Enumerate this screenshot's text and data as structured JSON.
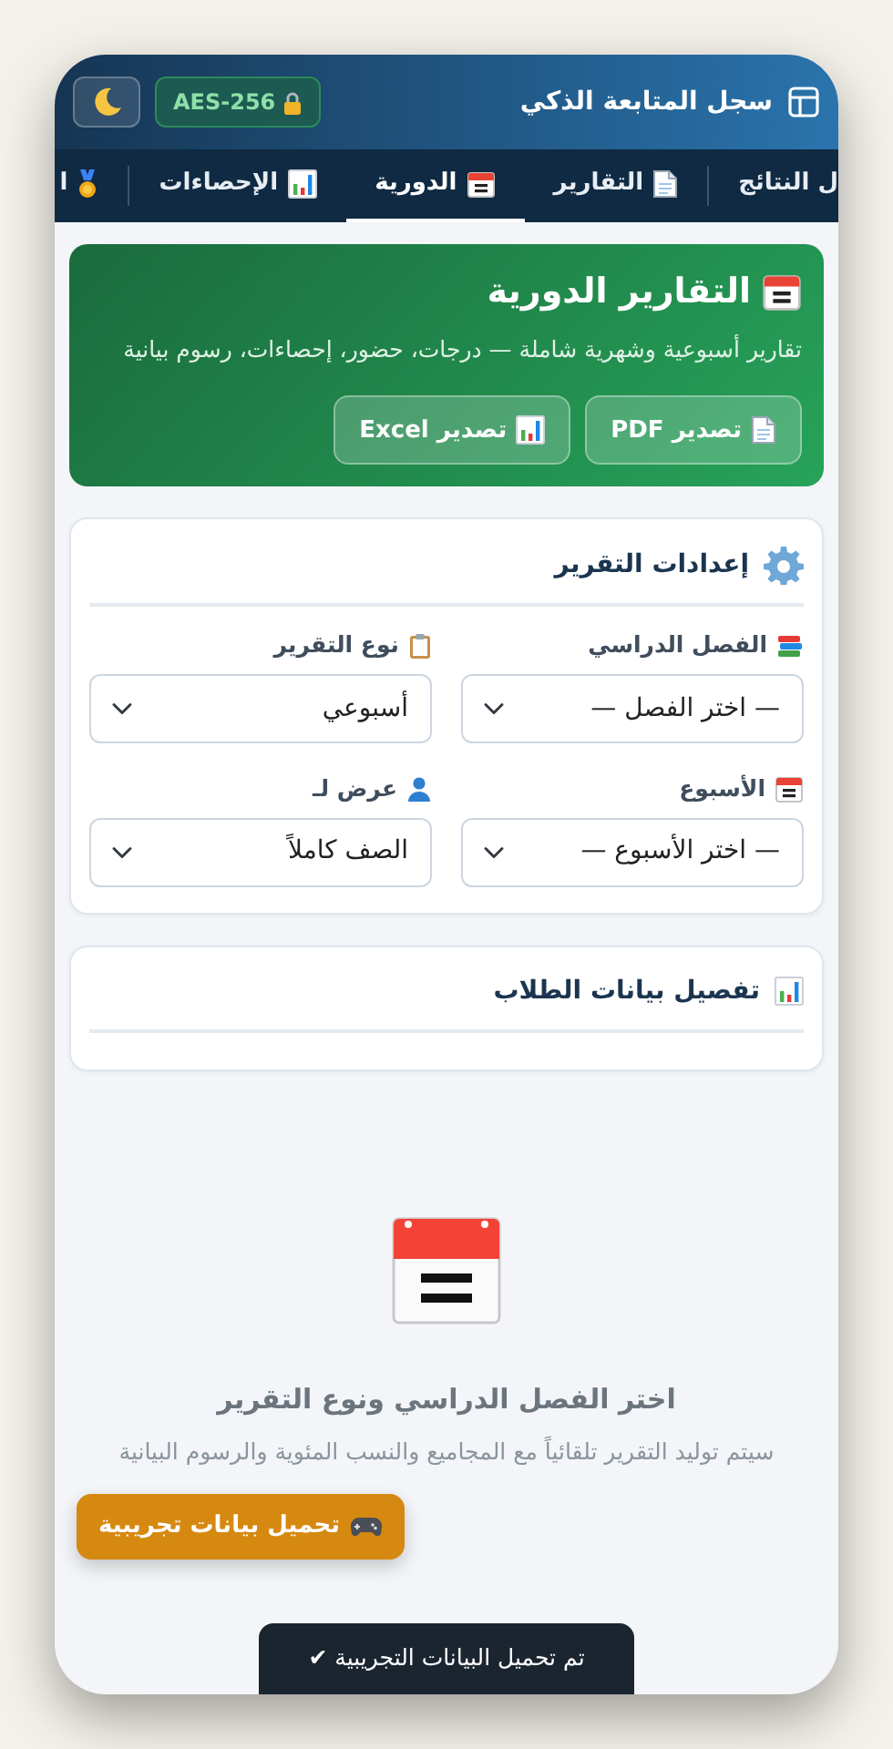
{
  "header": {
    "title": "سجل المتابعة الذكي",
    "encryption_badge": "AES-256"
  },
  "tabs": [
    {
      "label": "ل النتائج",
      "selected": false
    },
    {
      "label": "التقارير",
      "selected": false
    },
    {
      "label": "الدورية",
      "selected": true
    },
    {
      "label": "الإحصاءات",
      "selected": false
    },
    {
      "label": "ا",
      "selected": false
    }
  ],
  "hero": {
    "title": "التقارير الدورية",
    "subtitle": "تقارير أسبوعية وشهرية شاملة — درجات، حضور، إحصاءات، رسوم بيانية",
    "buttons": [
      "تصدير PDF",
      "تصدير Excel"
    ]
  },
  "settings": {
    "title": "إعدادات التقرير",
    "fields": [
      {
        "label": "الفصل الدراسي",
        "value": "— اختر الفصل —"
      },
      {
        "label": "نوع التقرير",
        "value": "أسبوعي"
      },
      {
        "label": "الأسبوع",
        "value": "— اختر الأسبوع —"
      },
      {
        "label": "عرض لـ",
        "value": "الصف كاملاً"
      }
    ]
  },
  "students_panel": {
    "title": "تفصيل بيانات الطلاب"
  },
  "empty_state": {
    "title": "اختر الفصل الدراسي ونوع التقرير",
    "message": "سيتم توليد التقرير تلقائياً مع المجاميع والنسب المئوية والرسوم البيانية"
  },
  "demo_button": "تحميل بيانات تجريبية",
  "toast": "تم تحميل البيانات التجريبية ✔"
}
